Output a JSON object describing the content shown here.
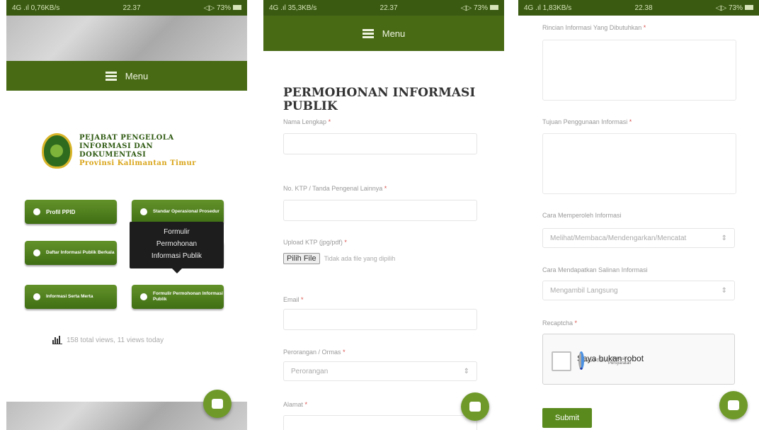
{
  "colors": {
    "brand_green": "#486a15",
    "button_green": "#5a8a1e",
    "required": "#d9534f",
    "logo_gold": "#d9a51a"
  },
  "status_bars": [
    {
      "left": "4G .ıl 0,76KB/s",
      "time": "22.37",
      "right": "◁▷ 73%"
    },
    {
      "left": "4G .ıl 35,3KB/s",
      "time": "22.37",
      "right": "◁▷ 73%"
    },
    {
      "left": "4G .ıl 1,83KB/s",
      "time": "22.38",
      "right": "◁▷ 73%"
    }
  ],
  "menu_label": "Menu",
  "home": {
    "logo_lines": [
      "PEJABAT PENGELOLA",
      "INFORMASI DAN DOKUMENTASI",
      "Provinsi Kalimantan Timur"
    ],
    "buttons": [
      {
        "label": "Profil PPID",
        "icon": "user-icon"
      },
      {
        "label": "Standar Operasional Prosedur",
        "icon": "gear-icon"
      },
      {
        "label": "Daftar Informasi Publik Berkala",
        "icon": "info-icon"
      },
      {
        "label": "Informasi Serta Merta",
        "icon": "alert-icon"
      },
      {
        "label": "Formulir Permohonan Informasi Publik",
        "icon": "chat-icon"
      }
    ],
    "tooltip_lines": [
      "Formulir",
      "Permohonan",
      "Informasi Publik"
    ],
    "views_text": "158 total views, 11 views today"
  },
  "form": {
    "title_lines": [
      "PERMOHONAN INFORMASI",
      "PUBLIK"
    ],
    "required_mark": "*",
    "fields": {
      "nama": "Nama Lengkap",
      "ktp": "No. KTP / Tanda Pengenal Lainnya",
      "upload": "Upload KTP (jpg/pdf)",
      "email": "Email",
      "jenis": "Perorangan / Ormas",
      "alamat": "Alamat"
    },
    "file_button": "Pilih File",
    "file_status": "Tidak ada file yang dipilih",
    "jenis_value": "Perorangan"
  },
  "form2": {
    "rincian": "Rincian Informasi Yang Dibutuhkan",
    "tujuan": "Tujuan Penggunaan Informasi",
    "cara_memperoleh": "Cara Memperoleh Informasi",
    "cara_memperoleh_value": "Melihat/Membaca/Mendengarkan/Mencatat",
    "cara_salinan": "Cara Mendapatkan Salinan Informasi",
    "cara_salinan_value": "Mengambil Langsung",
    "recaptcha_label": "Recaptcha",
    "recaptcha_text": "Saya bukan robot",
    "recaptcha_brand": "reCAPTCHA",
    "recaptcha_links": "Privasi - Persyaratan",
    "submit": "Submit"
  }
}
